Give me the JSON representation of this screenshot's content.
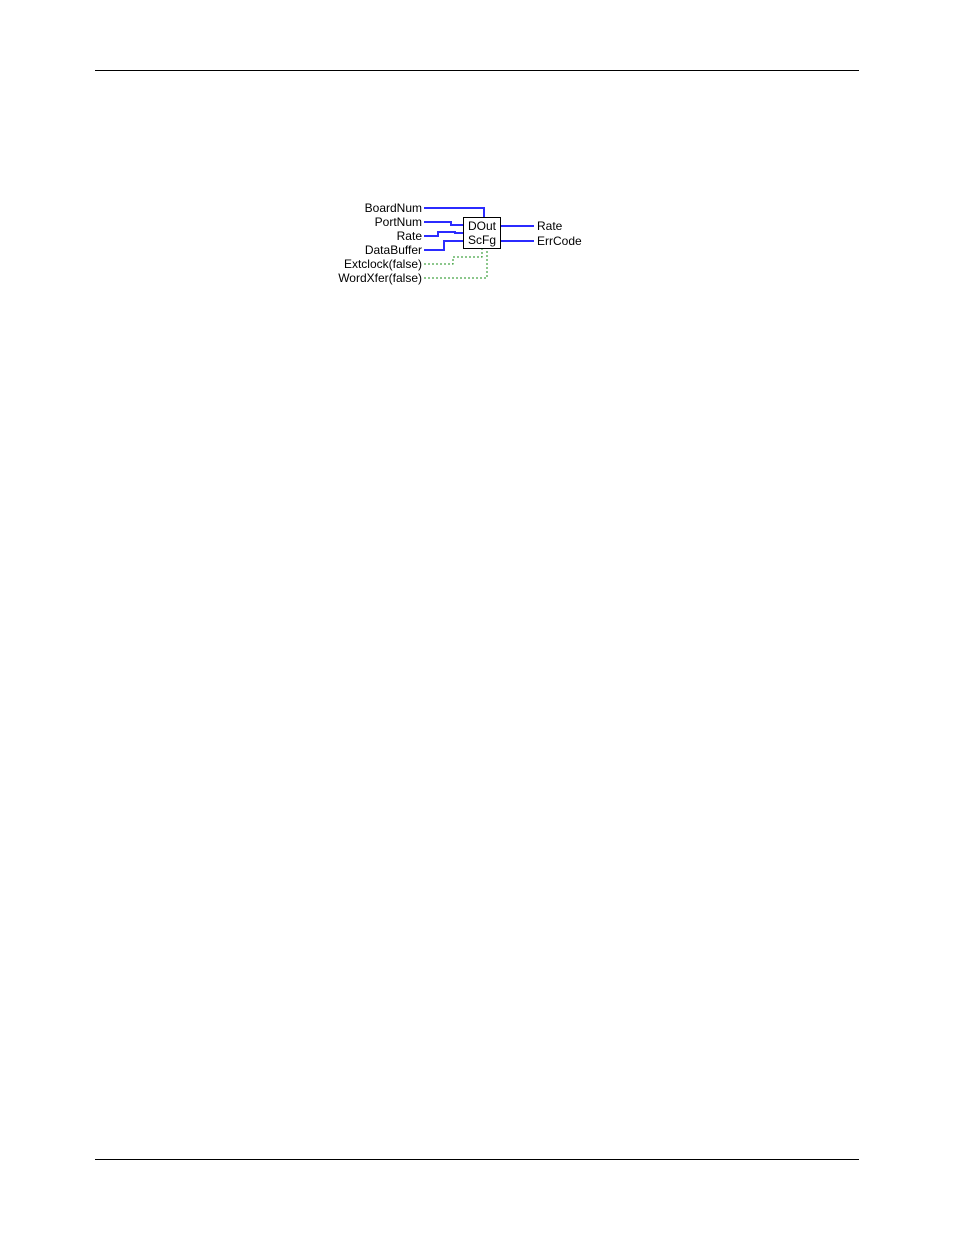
{
  "inputs": {
    "board_num": "BoardNum",
    "port_num": "PortNum",
    "rate": "Rate",
    "data_buffer": "DataBuffer",
    "extclock": "Extclock(false)",
    "wordxfer": "WordXfer(false)"
  },
  "block": {
    "line1": "DOut",
    "line2": "ScFg"
  },
  "outputs": {
    "rate": "Rate",
    "errcode": "ErrCode"
  }
}
